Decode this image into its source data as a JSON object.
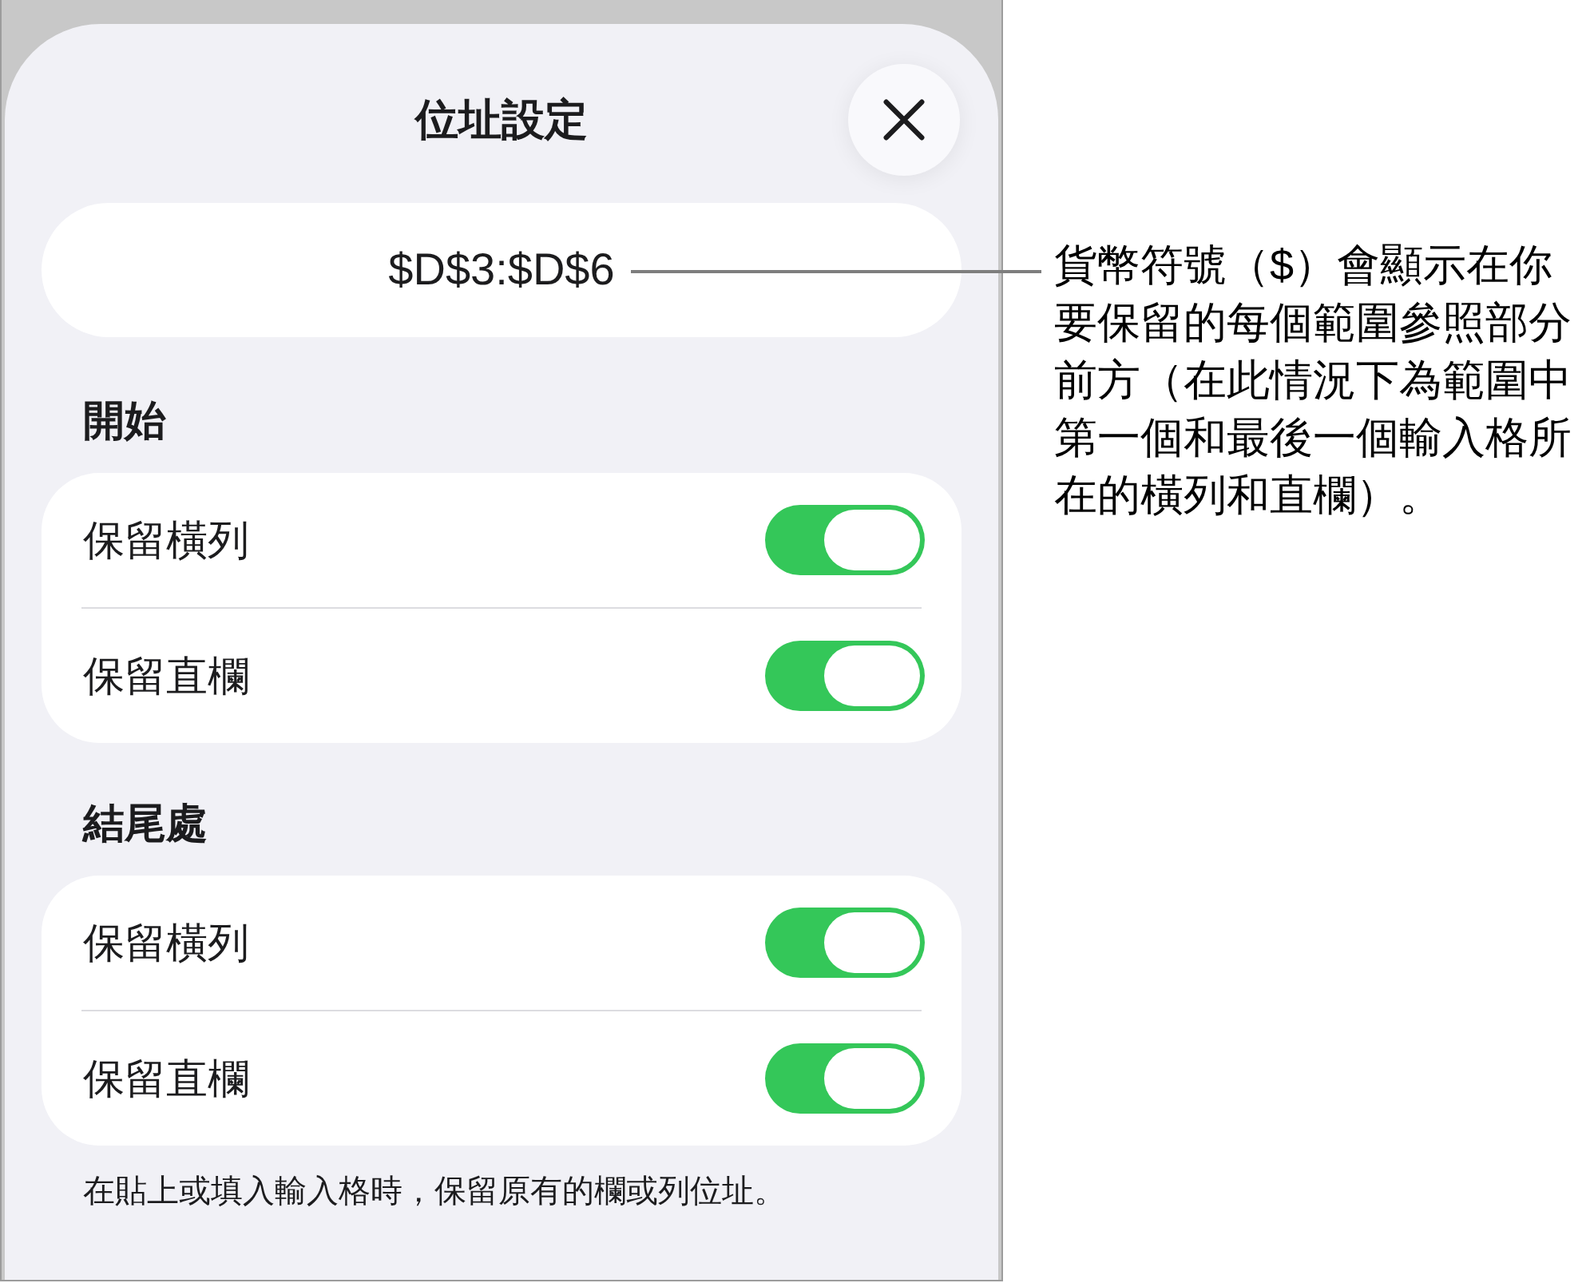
{
  "sheet": {
    "title": "位址設定",
    "address": "$D$3:$D$6"
  },
  "sections": [
    {
      "heading": "開始",
      "rows": [
        {
          "label": "保留橫列",
          "on": true
        },
        {
          "label": "保留直欄",
          "on": true
        }
      ]
    },
    {
      "heading": "結尾處",
      "rows": [
        {
          "label": "保留橫列",
          "on": true
        },
        {
          "label": "保留直欄",
          "on": true
        }
      ]
    }
  ],
  "footnote": "在貼上或填入輸入格時，保留原有的欄或列位址。",
  "callout": {
    "text": "貨幣符號（$）會顯示在你要保留的每個範圍參照部分前方（在此情況下為範圍中第一個和最後一個輸入格所在的橫列和直欄）。"
  }
}
